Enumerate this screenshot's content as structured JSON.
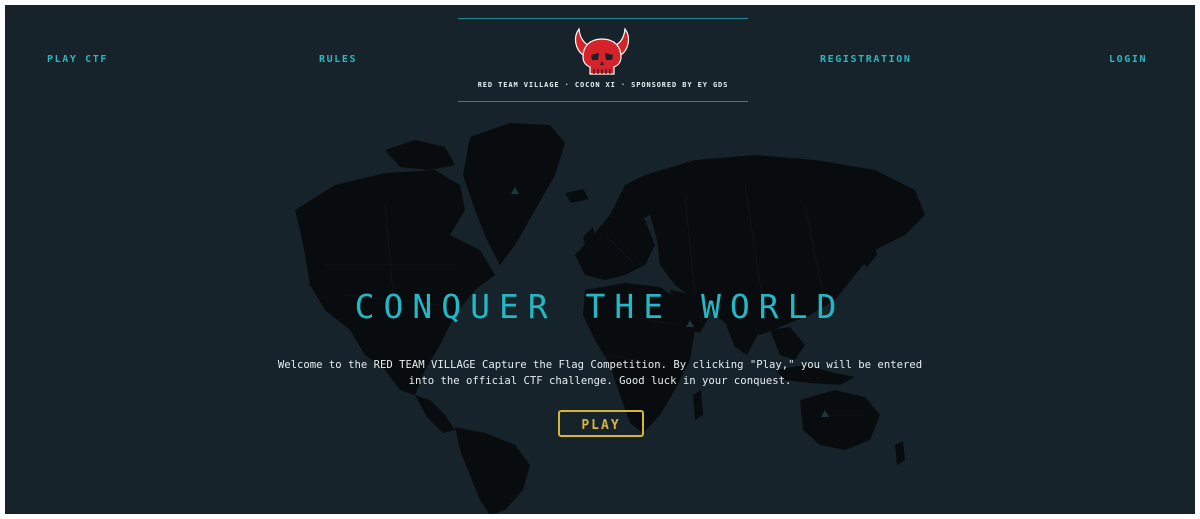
{
  "nav": {
    "play_ctf": "PLAY CTF",
    "rules": "RULES",
    "registration": "REGISTRATION",
    "login": "LOGIN"
  },
  "brand": {
    "logo_icon": "red-horned-skull-icon",
    "tagline": "RED TEAM VILLAGE · COCON XI · SPONSORED BY EY GDS"
  },
  "hero": {
    "title": "CONQUER THE WORLD",
    "description": "Welcome to the RED TEAM VILLAGE Capture the Flag Competition. By clicking \"Play,\" you will be entered into the official CTF challenge. Good luck in your conquest.",
    "play_label": "PLAY"
  },
  "colors": {
    "background": "#16232a",
    "accent_cyan": "#22b9c6",
    "accent_gold": "#d8b43a",
    "logo_red": "#d6232a",
    "map_fill": "#080c0e"
  }
}
